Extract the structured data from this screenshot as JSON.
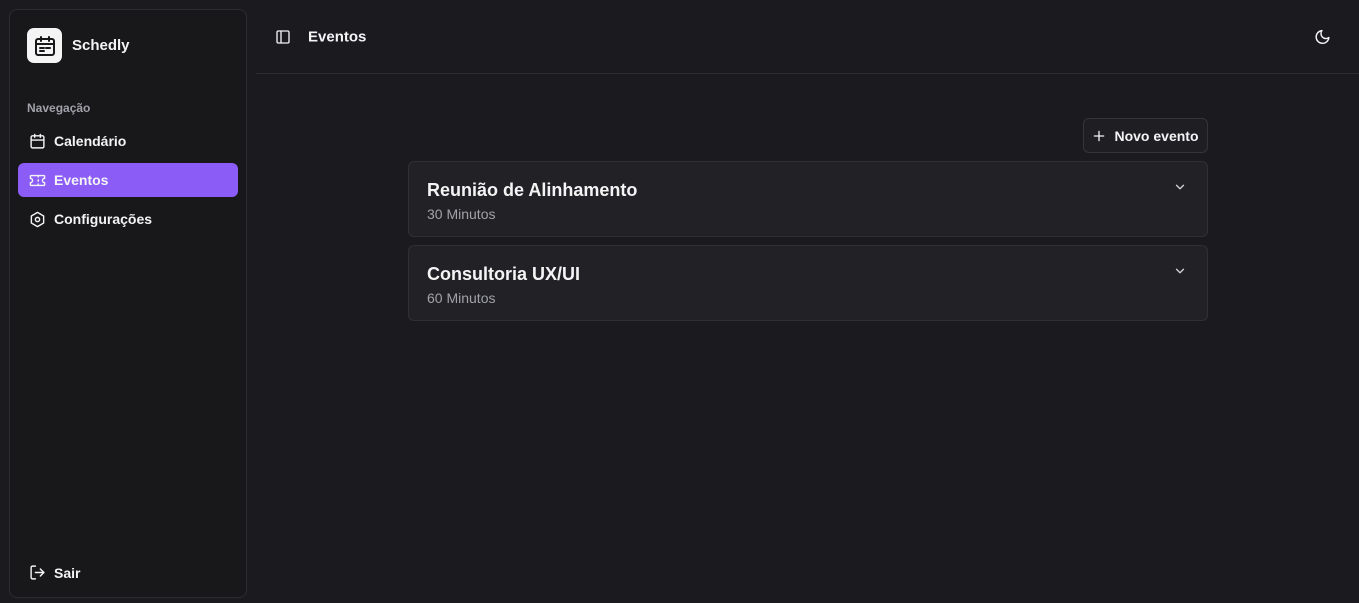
{
  "brand": {
    "name": "Schedly",
    "logo_icon": "calendar-icon"
  },
  "sidebar": {
    "section_label": "Navegação",
    "items": [
      {
        "label": "Calendário",
        "icon": "calendar-icon",
        "active": false
      },
      {
        "label": "Eventos",
        "icon": "ticket-icon",
        "active": true
      },
      {
        "label": "Configurações",
        "icon": "settings-icon",
        "active": false
      }
    ],
    "logout_label": "Sair"
  },
  "header": {
    "title": "Eventos"
  },
  "main": {
    "new_event_label": "Novo evento",
    "events": [
      {
        "title": "Reunião de Alinhamento",
        "duration": "30 Minutos"
      },
      {
        "title": "Consultoria UX/UI",
        "duration": "60 Minutos"
      }
    ]
  },
  "colors": {
    "accent": "#8b5cf6",
    "background": "#1b1b1f",
    "sidebar": "#18181b",
    "card": "#222226",
    "muted_text": "#a1a1aa"
  }
}
